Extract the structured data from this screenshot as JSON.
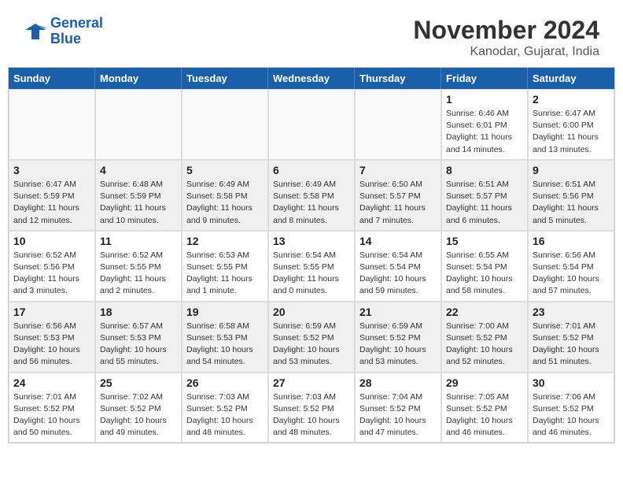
{
  "header": {
    "logo_line1": "General",
    "logo_line2": "Blue",
    "title": "November 2024",
    "subtitle": "Kanodar, Gujarat, India"
  },
  "weekdays": [
    "Sunday",
    "Monday",
    "Tuesday",
    "Wednesday",
    "Thursday",
    "Friday",
    "Saturday"
  ],
  "weeks": [
    [
      {
        "day": "",
        "info": ""
      },
      {
        "day": "",
        "info": ""
      },
      {
        "day": "",
        "info": ""
      },
      {
        "day": "",
        "info": ""
      },
      {
        "day": "",
        "info": ""
      },
      {
        "day": "1",
        "info": "Sunrise: 6:46 AM\nSunset: 6:01 PM\nDaylight: 11 hours\nand 14 minutes."
      },
      {
        "day": "2",
        "info": "Sunrise: 6:47 AM\nSunset: 6:00 PM\nDaylight: 11 hours\nand 13 minutes."
      }
    ],
    [
      {
        "day": "3",
        "info": "Sunrise: 6:47 AM\nSunset: 5:59 PM\nDaylight: 11 hours\nand 12 minutes."
      },
      {
        "day": "4",
        "info": "Sunrise: 6:48 AM\nSunset: 5:59 PM\nDaylight: 11 hours\nand 10 minutes."
      },
      {
        "day": "5",
        "info": "Sunrise: 6:49 AM\nSunset: 5:58 PM\nDaylight: 11 hours\nand 9 minutes."
      },
      {
        "day": "6",
        "info": "Sunrise: 6:49 AM\nSunset: 5:58 PM\nDaylight: 11 hours\nand 8 minutes."
      },
      {
        "day": "7",
        "info": "Sunrise: 6:50 AM\nSunset: 5:57 PM\nDaylight: 11 hours\nand 7 minutes."
      },
      {
        "day": "8",
        "info": "Sunrise: 6:51 AM\nSunset: 5:57 PM\nDaylight: 11 hours\nand 6 minutes."
      },
      {
        "day": "9",
        "info": "Sunrise: 6:51 AM\nSunset: 5:56 PM\nDaylight: 11 hours\nand 5 minutes."
      }
    ],
    [
      {
        "day": "10",
        "info": "Sunrise: 6:52 AM\nSunset: 5:56 PM\nDaylight: 11 hours\nand 3 minutes."
      },
      {
        "day": "11",
        "info": "Sunrise: 6:52 AM\nSunset: 5:55 PM\nDaylight: 11 hours\nand 2 minutes."
      },
      {
        "day": "12",
        "info": "Sunrise: 6:53 AM\nSunset: 5:55 PM\nDaylight: 11 hours\nand 1 minute."
      },
      {
        "day": "13",
        "info": "Sunrise: 6:54 AM\nSunset: 5:55 PM\nDaylight: 11 hours\nand 0 minutes."
      },
      {
        "day": "14",
        "info": "Sunrise: 6:54 AM\nSunset: 5:54 PM\nDaylight: 10 hours\nand 59 minutes."
      },
      {
        "day": "15",
        "info": "Sunrise: 6:55 AM\nSunset: 5:54 PM\nDaylight: 10 hours\nand 58 minutes."
      },
      {
        "day": "16",
        "info": "Sunrise: 6:56 AM\nSunset: 5:54 PM\nDaylight: 10 hours\nand 57 minutes."
      }
    ],
    [
      {
        "day": "17",
        "info": "Sunrise: 6:56 AM\nSunset: 5:53 PM\nDaylight: 10 hours\nand 56 minutes."
      },
      {
        "day": "18",
        "info": "Sunrise: 6:57 AM\nSunset: 5:53 PM\nDaylight: 10 hours\nand 55 minutes."
      },
      {
        "day": "19",
        "info": "Sunrise: 6:58 AM\nSunset: 5:53 PM\nDaylight: 10 hours\nand 54 minutes."
      },
      {
        "day": "20",
        "info": "Sunrise: 6:59 AM\nSunset: 5:52 PM\nDaylight: 10 hours\nand 53 minutes."
      },
      {
        "day": "21",
        "info": "Sunrise: 6:59 AM\nSunset: 5:52 PM\nDaylight: 10 hours\nand 53 minutes."
      },
      {
        "day": "22",
        "info": "Sunrise: 7:00 AM\nSunset: 5:52 PM\nDaylight: 10 hours\nand 52 minutes."
      },
      {
        "day": "23",
        "info": "Sunrise: 7:01 AM\nSunset: 5:52 PM\nDaylight: 10 hours\nand 51 minutes."
      }
    ],
    [
      {
        "day": "24",
        "info": "Sunrise: 7:01 AM\nSunset: 5:52 PM\nDaylight: 10 hours\nand 50 minutes."
      },
      {
        "day": "25",
        "info": "Sunrise: 7:02 AM\nSunset: 5:52 PM\nDaylight: 10 hours\nand 49 minutes."
      },
      {
        "day": "26",
        "info": "Sunrise: 7:03 AM\nSunset: 5:52 PM\nDaylight: 10 hours\nand 48 minutes."
      },
      {
        "day": "27",
        "info": "Sunrise: 7:03 AM\nSunset: 5:52 PM\nDaylight: 10 hours\nand 48 minutes."
      },
      {
        "day": "28",
        "info": "Sunrise: 7:04 AM\nSunset: 5:52 PM\nDaylight: 10 hours\nand 47 minutes."
      },
      {
        "day": "29",
        "info": "Sunrise: 7:05 AM\nSunset: 5:52 PM\nDaylight: 10 hours\nand 46 minutes."
      },
      {
        "day": "30",
        "info": "Sunrise: 7:06 AM\nSunset: 5:52 PM\nDaylight: 10 hours\nand 46 minutes."
      }
    ]
  ]
}
